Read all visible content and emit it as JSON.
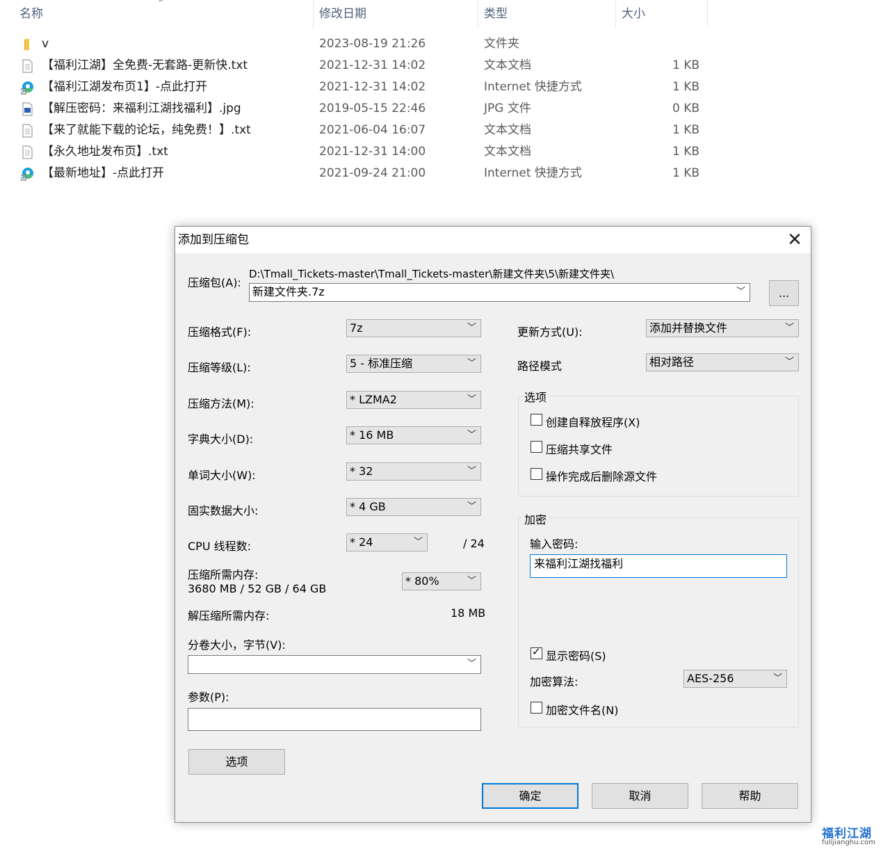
{
  "explorer": {
    "columns": {
      "name": "名称",
      "date": "修改日期",
      "type": "类型",
      "size": "大小"
    },
    "files": [
      {
        "icon": "folder-icon",
        "name": "v",
        "date": "2023-08-19 21:26",
        "type": "文件夹",
        "size": ""
      },
      {
        "icon": "text-file-icon",
        "name": "【福利江湖】全免费-无套路-更新快.txt",
        "date": "2021-12-31 14:02",
        "type": "文本文档",
        "size": "1 KB"
      },
      {
        "icon": "edge-shortcut-icon",
        "name": "【福利江湖发布页1】-点此打开",
        "date": "2021-12-31 14:02",
        "type": "Internet 快捷方式",
        "size": "1 KB"
      },
      {
        "icon": "image-file-icon",
        "name": "【解压密码：来福利江湖找福利】.jpg",
        "date": "2019-05-15 22:46",
        "type": "JPG 文件",
        "size": "0 KB"
      },
      {
        "icon": "text-file-icon",
        "name": "【来了就能下载的论坛，纯免费！】.txt",
        "date": "2021-06-04 16:07",
        "type": "文本文档",
        "size": "1 KB"
      },
      {
        "icon": "text-file-icon",
        "name": "【永久地址发布页】.txt",
        "date": "2021-12-31 14:00",
        "type": "文本文档",
        "size": "1 KB"
      },
      {
        "icon": "edge-shortcut-icon",
        "name": "【最新地址】-点此打开",
        "date": "2021-09-24 21:00",
        "type": "Internet 快捷方式",
        "size": "1 KB"
      }
    ]
  },
  "dialog": {
    "title": "添加到压缩包",
    "archive_label": "压缩包(A):",
    "archive_path": "D:\\Tmall_Tickets-master\\Tmall_Tickets-master\\新建文件夹\\5\\新建文件夹\\",
    "archive_name": "新建文件夹.7z",
    "browse_label": "...",
    "left": {
      "format_label": "压缩格式(F):",
      "format_value": "7z",
      "level_label": "压缩等级(L):",
      "level_value": "5 - 标准压缩",
      "method_label": "压缩方法(M):",
      "method_value": "*  LZMA2",
      "dict_label": "字典大小(D):",
      "dict_value": "*  16 MB",
      "word_label": "单词大小(W):",
      "word_value": "*  32",
      "solid_label": "固实数据大小:",
      "solid_value": "*  4 GB",
      "cpu_label": "CPU 线程数:",
      "cpu_value": "*  24",
      "cpu_total": "/ 24",
      "mem_label": "压缩所需内存:",
      "mem_value": "3680 MB / 52 GB / 64 GB",
      "mem_percent": "*  80%",
      "decomp_label": "解压缩所需内存:",
      "decomp_value": "18 MB",
      "volume_label": "分卷大小，字节(V):",
      "volume_value": "",
      "params_label": "参数(P):",
      "params_value": "",
      "options_button": "选项"
    },
    "right": {
      "update_label": "更新方式(U):",
      "update_value": "添加并替换文件",
      "path_label": "路径模式",
      "path_value": "相对路径",
      "options_group": "选项",
      "sfx_label": "创建自释放程序(X)",
      "shared_label": "压缩共享文件",
      "delete_label": "操作完成后删除源文件",
      "encrypt_group": "加密",
      "password_label": "输入密码:",
      "password_value": "来福利江湖找福利",
      "show_password_label": "显示密码(S)",
      "show_password_checked": true,
      "algo_label": "加密算法:",
      "algo_value": "AES-256",
      "encrypt_names_label": "加密文件名(N)"
    },
    "buttons": {
      "ok": "确定",
      "cancel": "取消",
      "help": "帮助"
    }
  },
  "watermark": {
    "cn": "福利江湖",
    "url": "fulijianghu.com"
  }
}
